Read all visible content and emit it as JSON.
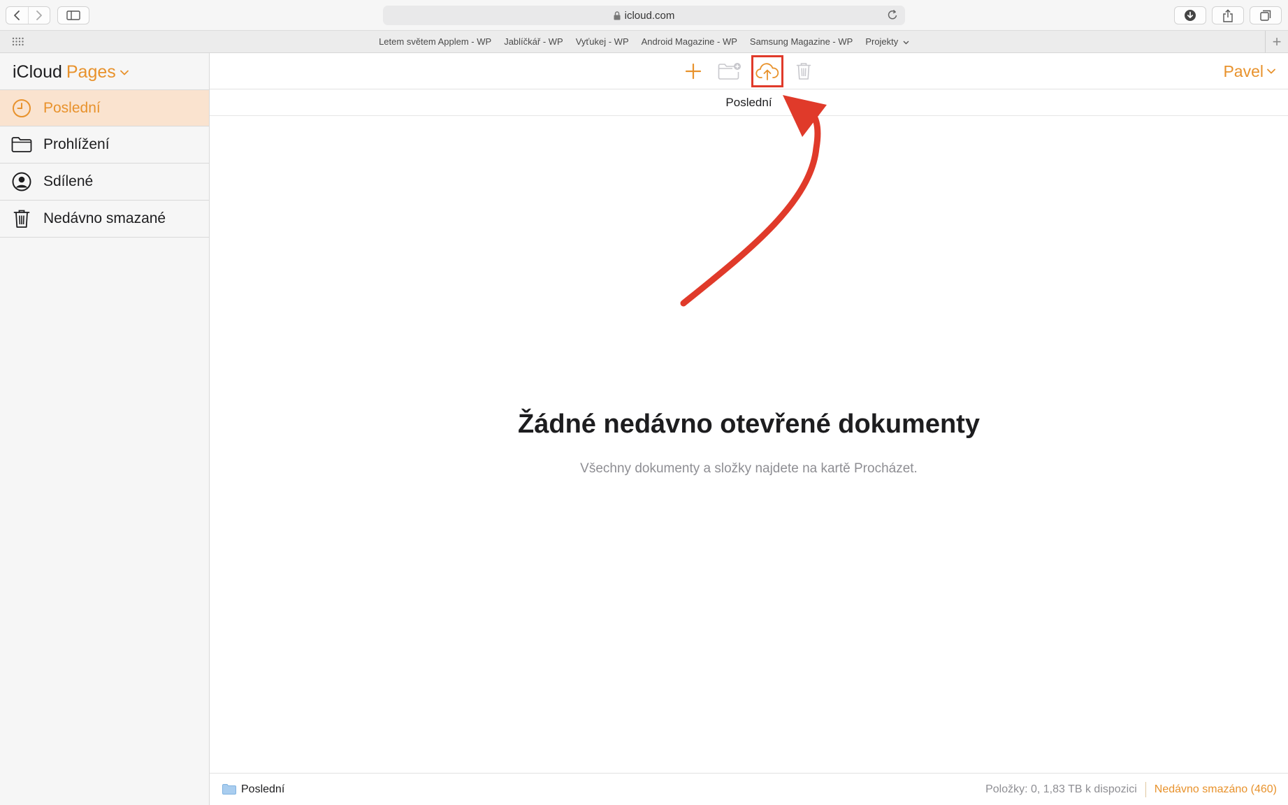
{
  "browser": {
    "url": "icloud.com",
    "favorites": [
      "Letem světem Applem - WP",
      "Jablíčkář - WP",
      "Vyťukej - WP",
      "Android Magazine - WP",
      "Samsung Magazine - WP",
      "Projekty"
    ]
  },
  "sidebar": {
    "brand": "iCloud",
    "app_name": "Pages",
    "items": [
      {
        "label": "Poslední",
        "icon": "clock-icon",
        "active": true
      },
      {
        "label": "Prohlížení",
        "icon": "folder-icon",
        "active": false
      },
      {
        "label": "Sdílené",
        "icon": "person-circle-icon",
        "active": false
      },
      {
        "label": "Nedávno smazané",
        "icon": "trash-icon",
        "active": false
      }
    ]
  },
  "toolbar": {
    "icons": [
      "plus-icon",
      "new-folder-icon",
      "cloud-upload-icon",
      "trash-icon"
    ],
    "user_name": "Pavel"
  },
  "main": {
    "breadcrumb": "Poslední",
    "empty_title": "Žádné nedávno otevřené dokumenty",
    "empty_subtitle": "Všechny dokumenty a složky najdete na kartě Procházet."
  },
  "status": {
    "location": "Poslední",
    "info": "Položky: 0, 1,83 TB k dispozici",
    "recently_deleted": "Nedávno smazáno (460)"
  },
  "colors": {
    "accent": "#e8922c",
    "active_bg": "#fae3cf",
    "annotation": "#e03a2a"
  }
}
